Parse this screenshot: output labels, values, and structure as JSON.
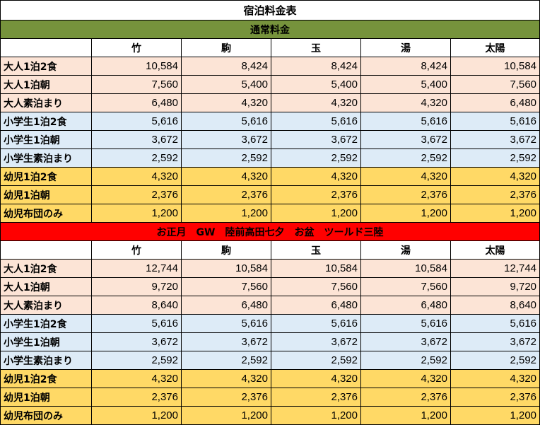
{
  "title": "宿泊料金表",
  "columns": [
    "竹",
    "駒",
    "玉",
    "湯",
    "太陽"
  ],
  "sections": [
    {
      "label": "通常料金",
      "color": "#76933c",
      "rows": [
        {
          "group": "adult",
          "label": "大人1泊2食",
          "values": [
            "10,584",
            "8,424",
            "8,424",
            "8,424",
            "10,584"
          ]
        },
        {
          "group": "adult",
          "label": "大人1泊朝",
          "values": [
            "7,560",
            "5,400",
            "5,400",
            "5,400",
            "7,560"
          ]
        },
        {
          "group": "adult",
          "label": "大人素泊まり",
          "values": [
            "6,480",
            "4,320",
            "4,320",
            "4,320",
            "6,480"
          ]
        },
        {
          "group": "child",
          "label": "小学生1泊2食",
          "values": [
            "5,616",
            "5,616",
            "5,616",
            "5,616",
            "5,616"
          ]
        },
        {
          "group": "child",
          "label": "小学生1泊朝",
          "values": [
            "3,672",
            "3,672",
            "3,672",
            "3,672",
            "3,672"
          ]
        },
        {
          "group": "child",
          "label": "小学生素泊まり",
          "values": [
            "2,592",
            "2,592",
            "2,592",
            "2,592",
            "2,592"
          ]
        },
        {
          "group": "infant",
          "label": "幼児1泊2食",
          "values": [
            "4,320",
            "4,320",
            "4,320",
            "4,320",
            "4,320"
          ]
        },
        {
          "group": "infant",
          "label": "幼児1泊朝",
          "values": [
            "2,376",
            "2,376",
            "2,376",
            "2,376",
            "2,376"
          ]
        },
        {
          "group": "infant",
          "label": "幼児布団のみ",
          "values": [
            "1,200",
            "1,200",
            "1,200",
            "1,200",
            "1,200"
          ]
        }
      ]
    },
    {
      "label": "お正月　GW　陸前高田七夕　お盆　ツールド三陸",
      "color": "#ff0000",
      "rows": [
        {
          "group": "adult",
          "label": "大人1泊2食",
          "values": [
            "12,744",
            "10,584",
            "10,584",
            "10,584",
            "12,744"
          ]
        },
        {
          "group": "adult",
          "label": "大人1泊朝",
          "values": [
            "9,720",
            "7,560",
            "7,560",
            "7,560",
            "9,720"
          ]
        },
        {
          "group": "adult",
          "label": "大人素泊まり",
          "values": [
            "8,640",
            "6,480",
            "6,480",
            "6,480",
            "8,640"
          ]
        },
        {
          "group": "child",
          "label": "小学生1泊2食",
          "values": [
            "5,616",
            "5,616",
            "5,616",
            "5,616",
            "5,616"
          ]
        },
        {
          "group": "child",
          "label": "小学生1泊朝",
          "values": [
            "3,672",
            "3,672",
            "3,672",
            "3,672",
            "3,672"
          ]
        },
        {
          "group": "child",
          "label": "小学生素泊まり",
          "values": [
            "2,592",
            "2,592",
            "2,592",
            "2,592",
            "2,592"
          ]
        },
        {
          "group": "infant",
          "label": "幼児1泊2食",
          "values": [
            "4,320",
            "4,320",
            "4,320",
            "4,320",
            "4,320"
          ]
        },
        {
          "group": "infant",
          "label": "幼児1泊朝",
          "values": [
            "2,376",
            "2,376",
            "2,376",
            "2,376",
            "2,376"
          ]
        },
        {
          "group": "infant",
          "label": "幼児布団のみ",
          "values": [
            "1,200",
            "1,200",
            "1,200",
            "1,200",
            "1,200"
          ]
        }
      ]
    }
  ],
  "colors": {
    "adult": "#fce4d6",
    "child": "#ddebf7",
    "infant": "#ffd966"
  }
}
